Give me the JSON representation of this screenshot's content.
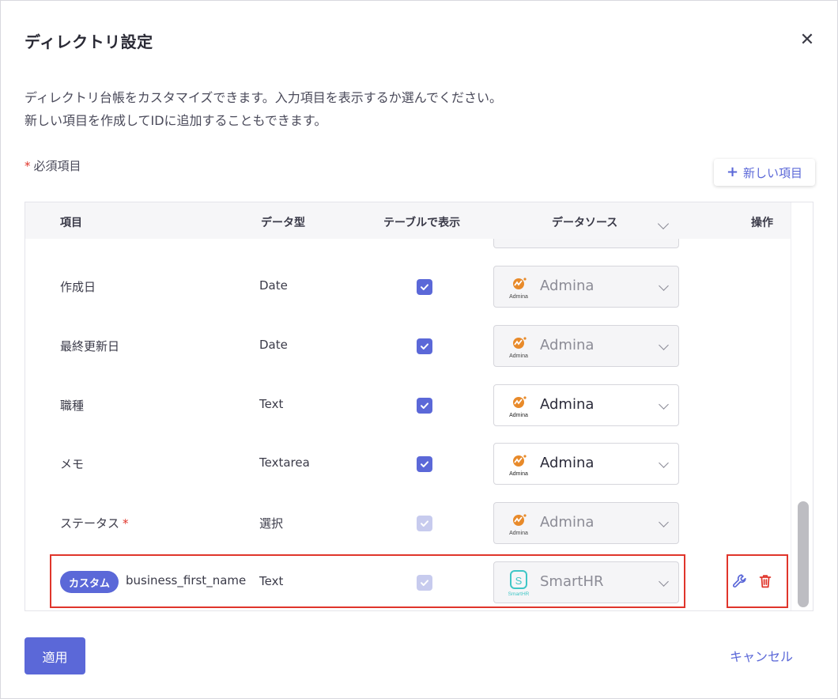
{
  "dialog": {
    "title": "ディレクトリ設定",
    "description_line1": "ディレクトリ台帳をカスタマイズできます。入力項目を表示するか選んでください。",
    "description_line2": "新しい項目を作成してIDに追加することもできます。",
    "required_note": "必須項目",
    "new_item_label": "新しい項目",
    "apply_label": "適用",
    "cancel_label": "キャンセル"
  },
  "table": {
    "headers": {
      "item": "項目",
      "data_type": "データ型",
      "show_in_table": "テーブルで表示",
      "data_source": "データソース",
      "actions": "操作"
    },
    "rows": [
      {
        "name": "作成日",
        "type": "Date",
        "checked": true,
        "checkbox_disabled": false,
        "source": "Admina",
        "source_disabled": true
      },
      {
        "name": "最終更新日",
        "type": "Date",
        "checked": true,
        "checkbox_disabled": false,
        "source": "Admina",
        "source_disabled": true
      },
      {
        "name": "職種",
        "type": "Text",
        "checked": true,
        "checkbox_disabled": false,
        "source": "Admina",
        "source_disabled": false
      },
      {
        "name": "メモ",
        "type": "Textarea",
        "checked": true,
        "checkbox_disabled": false,
        "source": "Admina",
        "source_disabled": false
      },
      {
        "name": "ステータス",
        "required": true,
        "type": "選択",
        "checked": true,
        "checkbox_disabled": true,
        "source": "Admina",
        "source_disabled": true
      },
      {
        "badge": "カスタム",
        "name": "business_first_name",
        "type": "Text",
        "checked": true,
        "checkbox_disabled": true,
        "source": "SmartHR",
        "source_disabled": true
      }
    ]
  },
  "logos": {
    "admina_text": "Admina",
    "smarthr_text": "SmartHR",
    "smarthr_letter": "S"
  },
  "colors": {
    "accent": "#5b68d8",
    "danger": "#e0352b",
    "admina_orange": "#e88a2a",
    "smarthr_teal": "#3fc6c6"
  },
  "icons": {
    "close": "close-icon",
    "plus": "plus-icon",
    "wrench": "wrench-icon",
    "trash": "trash-icon"
  }
}
